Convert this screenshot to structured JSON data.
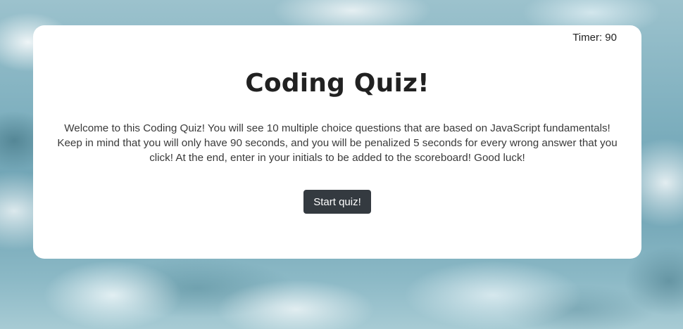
{
  "timer": {
    "label": "Timer: 90"
  },
  "quiz": {
    "title": "Coding Quiz!",
    "intro": "Welcome to this Coding Quiz! You will see 10 multiple choice questions that are based on JavaScript fundamentals! Keep in mind that you will only have 90 seconds, and you will be penalized 5 seconds for every wrong answer that you click! At the end, enter in your initials to be added to the scoreboard! Good luck!",
    "start_label": "Start quiz!"
  },
  "colors": {
    "card_background": "#ffffff",
    "button_background": "#343a40",
    "button_text": "#ffffff",
    "title_text": "#212121"
  }
}
